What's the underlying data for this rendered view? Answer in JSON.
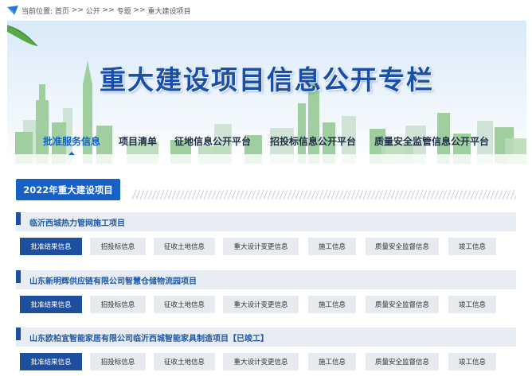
{
  "breadcrumb": {
    "prefix": "当前位置:",
    "items": [
      "首页",
      "公开",
      "专题",
      "重大建设项目"
    ],
    "separator": ">>"
  },
  "banner": {
    "title": "重大建设项目信息公开专栏",
    "nav": [
      {
        "label": "批准服务信息",
        "active": true
      },
      {
        "label": "项目清单",
        "active": false
      },
      {
        "label": "征地信息公开平台",
        "active": false
      },
      {
        "label": "招投标信息公开平台",
        "active": false
      },
      {
        "label": "质量安全监管信息公开平台",
        "active": false
      }
    ]
  },
  "section": {
    "year_label": "2022年重大建设项目"
  },
  "projects": [
    {
      "name": "临沂西城热力管网施工项目",
      "buttons": [
        "批准结果信息",
        "招投标信息",
        "征收土地信息",
        "重大设计变更信息",
        "施工信息",
        "质量安全监督信息",
        "竣工信息"
      ]
    },
    {
      "name": "山东新明辉供应链有限公司智慧仓储物流园项目",
      "buttons": [
        "批准结果信息",
        "招投标信息",
        "征收土地信息",
        "重大设计变更信息",
        "施工信息",
        "质量安全监督信息",
        "竣工信息"
      ]
    },
    {
      "name": "山东欧柏宜智能家居有限公司临沂西城智能家具制造项目【已竣工】",
      "buttons": [
        "批准结果信息",
        "招投标信息",
        "征收土地信息",
        "重大设计变更信息",
        "施工信息",
        "质量安全监督信息",
        "竣工信息"
      ]
    }
  ],
  "colors": {
    "accent": "#1760c5",
    "button_primary": "#1d4f9e",
    "title_text": "#1a4fa6"
  }
}
